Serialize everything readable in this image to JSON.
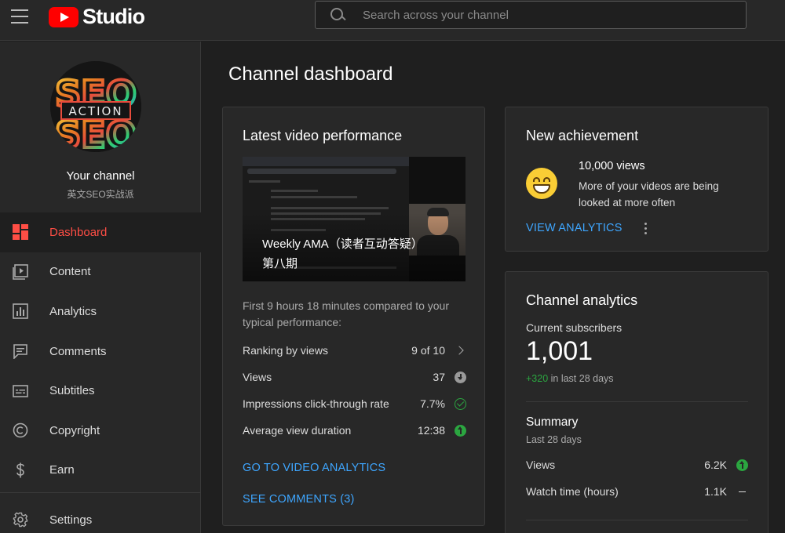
{
  "header": {
    "brand": "Studio",
    "search_placeholder": "Search across your channel"
  },
  "sidebar": {
    "channel_title": "Your channel",
    "channel_name": "英文SEO实战派",
    "avatar_text_top": "SEO",
    "avatar_text_badge": "ACTION",
    "nav": [
      {
        "label": "Dashboard",
        "icon": "dashboard-icon",
        "active": true
      },
      {
        "label": "Content",
        "icon": "content-icon"
      },
      {
        "label": "Analytics",
        "icon": "analytics-icon"
      },
      {
        "label": "Comments",
        "icon": "comments-icon"
      },
      {
        "label": "Subtitles",
        "icon": "subtitles-icon"
      },
      {
        "label": "Copyright",
        "icon": "copyright-icon"
      },
      {
        "label": "Earn",
        "icon": "earn-icon"
      }
    ],
    "settings_label": "Settings"
  },
  "main": {
    "page_title": "Channel dashboard",
    "video_card": {
      "title": "Latest video performance",
      "video_title_line1": "Weekly AMA（读者互动答疑）",
      "video_title_line2": "第八期",
      "compare_text": "First 9 hours 18 minutes compared to your typical performance:",
      "metrics": [
        {
          "label": "Ranking by views",
          "value": "9 of 10",
          "indicator": "chevron-right-icon"
        },
        {
          "label": "Views",
          "value": "37",
          "indicator": "arrow-down-icon"
        },
        {
          "label": "Impressions click-through rate",
          "value": "7.7%",
          "indicator": "check-circle-icon"
        },
        {
          "label": "Average view duration",
          "value": "12:38",
          "indicator": "arrow-up-icon"
        }
      ],
      "analytics_link": "GO TO VIDEO ANALYTICS",
      "comments_link": "SEE COMMENTS (3)"
    },
    "achievement_card": {
      "title": "New achievement",
      "headline": "10,000 views",
      "text": "More of your videos are being looked at more often",
      "link": "VIEW ANALYTICS"
    },
    "analytics_card": {
      "title": "Channel analytics",
      "subscribers_label": "Current subscribers",
      "subscribers": "1,001",
      "growth_value": "+320",
      "growth_period": " in last 28 days",
      "summary_title": "Summary",
      "summary_period": "Last 28 days",
      "summary": [
        {
          "label": "Views",
          "value": "6.2K",
          "indicator": "arrow-up-icon"
        },
        {
          "label": "Watch time (hours)",
          "value": "1.1K",
          "indicator": "dash-icon"
        }
      ]
    }
  },
  "colors": {
    "accent_red": "#ff4e45",
    "link_blue": "#3ea6ff",
    "positive_green": "#2ba640",
    "background": "#1f1f1f",
    "surface": "#282828"
  }
}
